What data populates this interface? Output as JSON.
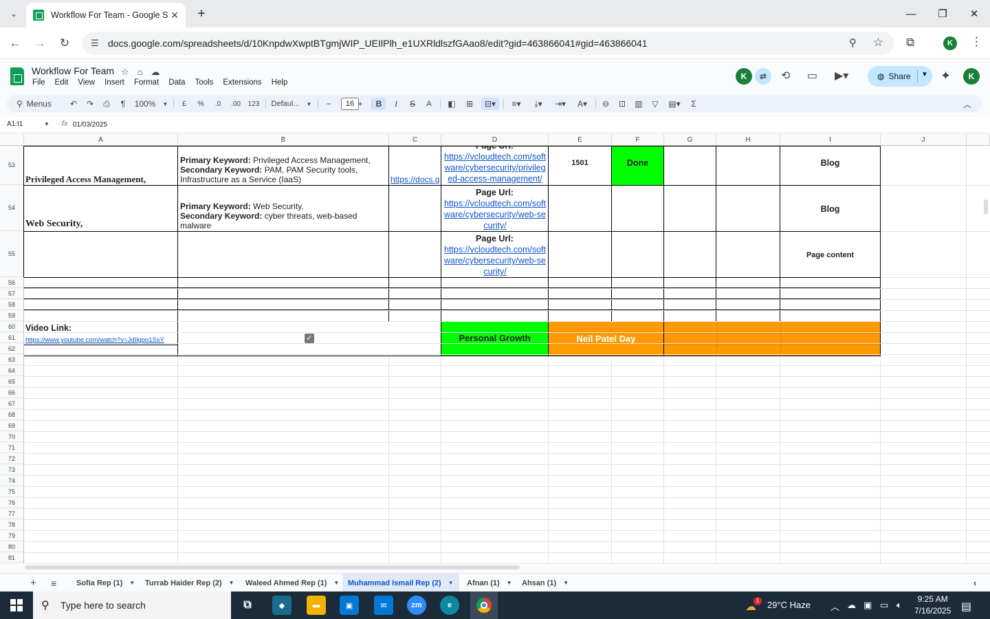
{
  "browser": {
    "tab_title": "Workflow For Team - Google Sh",
    "url": "docs.google.com/spreadsheets/d/10KnpdwXwptBTgmjWIP_UEIlPlh_e1UXRldlszfGAao8/edit?gid=463866041#gid=463866041",
    "profile_initial": "K"
  },
  "sheets": {
    "doc_title": "Workflow For Team",
    "menus": [
      "File",
      "Edit",
      "View",
      "Insert",
      "Format",
      "Data",
      "Tools",
      "Extensions",
      "Help"
    ],
    "share_label": "Share",
    "collaborator_initial": "K",
    "user_initial": "K"
  },
  "toolbar": {
    "menus_label": "Menus",
    "zoom": "100%",
    "currency": "£",
    "percent": "%",
    "dec_decrease": ".0",
    "dec_increase": ".00",
    "number_format": "123",
    "font": "Defaul...",
    "font_size": "16",
    "bold": "B",
    "italic": "I",
    "strike": "S",
    "text_color": "A",
    "sum": "Σ"
  },
  "formula_bar": {
    "name_box": "A1:I1",
    "fx": "fx",
    "value": "01/03/2025"
  },
  "columns": [
    "A",
    "B",
    "C",
    "D",
    "E",
    "F",
    "G",
    "H",
    "I",
    "J"
  ],
  "rows": {
    "r53": {
      "num": "53",
      "a": "Privileged Access Management,",
      "b_primary_label": "Primary Keyword:",
      "b_primary": " Privileged Access Management,",
      "b_secondary_label": "Secondary Keyword:",
      "b_secondary": " PAM, PAM Security tools, Infrastructure as a Service (IaaS)",
      "c": "https://docs.g",
      "d_label": "Page Url:",
      "d_link": "https://vcloudtech.com/software/cybersecurity/privileged-access-management/",
      "e": "1501",
      "f": "Done",
      "i": "Blog"
    },
    "r54": {
      "num": "54",
      "a": "Web Security,",
      "b_primary_label": "Primary Keyword:",
      "b_primary": " Web Security,",
      "b_secondary_label": "Secondary Keyword:",
      "b_secondary": " cyber threats, web-based malware",
      "d_label": "Page Url:",
      "d_link": "https://vcloudtech.com/software/cybersecurity/web-security/",
      "i": "Blog"
    },
    "r55": {
      "num": "55",
      "d_label": "Page Url:",
      "d_link": "https://vcloudtech.com/software/cybersecurity/web-security/",
      "i": "Page content"
    },
    "r60": {
      "video_label": "Video Link:",
      "video_link": "https://www.youtube.com/watch?v=JdIlgpo1SsY",
      "growth": "Personal Growth",
      "neil": "Neil Patel Day"
    },
    "small_nums": [
      "56",
      "57",
      "58",
      "59",
      "60",
      "61",
      "62",
      "63",
      "64",
      "65",
      "66",
      "67",
      "68",
      "69",
      "70",
      "71",
      "72",
      "73",
      "74",
      "75",
      "76",
      "77",
      "78",
      "79",
      "80",
      "81"
    ]
  },
  "sheet_tabs": [
    {
      "label": "Sofia Rep (1)"
    },
    {
      "label": "Turrab Haider Rep (2)"
    },
    {
      "label": "Waleed Ahmed Rep (1)"
    },
    {
      "label": "Muhammad Ismail Rep (2)"
    },
    {
      "label": "Afnan (1)"
    },
    {
      "label": "Ahsan (1)"
    }
  ],
  "taskbar": {
    "search_placeholder": "Type here to search",
    "weather": "29°C  Haze",
    "weather_badge": "1",
    "time": "9:25 AM",
    "date": "7/16/2025"
  },
  "colors": {
    "green": "#00ff00",
    "orange": "#ff9900",
    "link": "#1155cc"
  }
}
